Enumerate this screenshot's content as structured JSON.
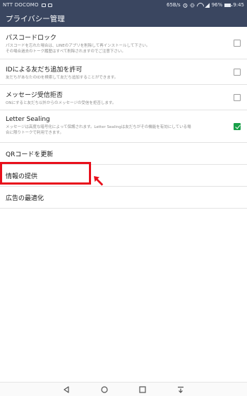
{
  "status_bar": {
    "carrier": "NTT DOCOMO",
    "speed": "65B/s",
    "battery": "96%",
    "time": "9:45",
    "icons": [
      "notification-icon",
      "notification-icon",
      "data-speed",
      "alarm-icon",
      "vibrate-icon",
      "wifi-icon",
      "signal-icon",
      "battery-icon"
    ]
  },
  "header": {
    "title": "プライバシー管理"
  },
  "settings": {
    "passcode": {
      "title": "パスコードロック",
      "desc1": "パスコードを忘れた場合は、LINEのアプリを削除して再インストールして下さい。",
      "desc2": "その場合過去のトーク履歴はすべて削除されますのでご注意下さい。",
      "checked": false
    },
    "id_add": {
      "title": "IDによる友だち追加を許可",
      "desc": "友だちがあなたのIDを検索して友だち追加することができます。",
      "checked": false
    },
    "msg_reject": {
      "title": "メッセージ受信拒否",
      "desc": "ONにすると友だち以外からのメッセージの受信を拒否します。",
      "checked": false
    },
    "sealing": {
      "title": "Letter Sealing",
      "desc1": "メッセージは高度な暗号化によって保護されます。Letter Sealingは友だちがその機能を有効にしている場",
      "desc2": "合に限りトークで利用できます。",
      "checked": true
    },
    "qr_update": {
      "title": "QRコードを更新"
    },
    "info_provide": {
      "title": "情報の提供"
    },
    "ad_optimize": {
      "title": "広告の最適化"
    }
  },
  "colors": {
    "header_bg": "#3a4660",
    "highlight": "#e8101c",
    "check_on": "#19a049"
  },
  "annotation": {
    "icon": "red-arrow-icon"
  },
  "nav": {
    "icons": [
      "back-icon",
      "home-icon",
      "recents-icon",
      "notification-pull-icon"
    ]
  }
}
